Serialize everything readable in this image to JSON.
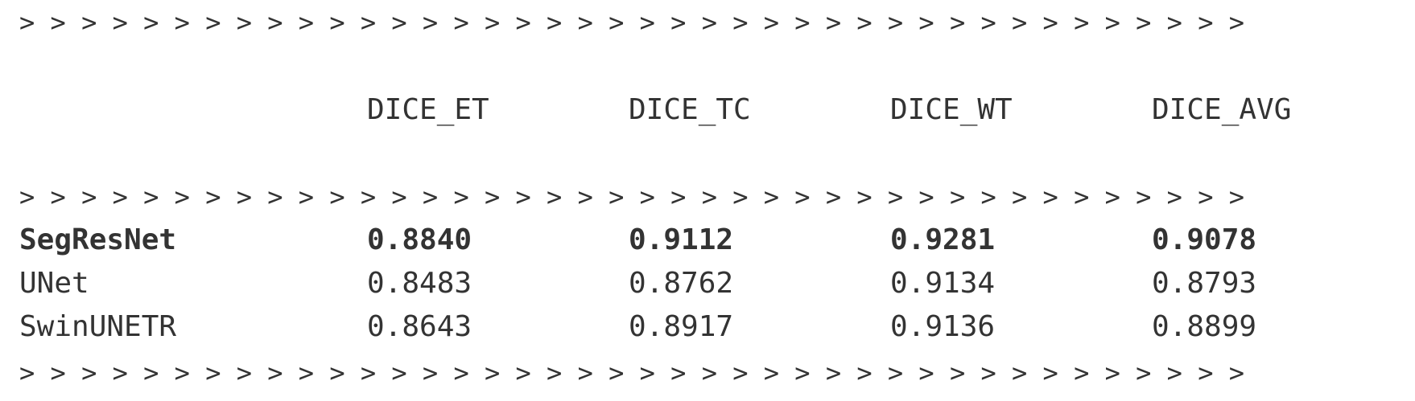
{
  "separator": "> > > > > > > > > > > > > > > > > > > > > > > > > > > > > > > > > > > > > > > >",
  "table": {
    "headers": [
      "",
      "DICE_ET",
      "DICE_TC",
      "DICE_WT",
      "DICE_AVG"
    ],
    "rows": [
      {
        "model": "SegResNet",
        "values": [
          "0.8840",
          "0.9112",
          "0.9281",
          "0.9078"
        ],
        "bold": true
      },
      {
        "model": "UNet",
        "values": [
          "0.8483",
          "0.8762",
          "0.9134",
          "0.8793"
        ],
        "bold": false
      },
      {
        "model": "SwinUNETR",
        "values": [
          "0.8643",
          "0.8917",
          "0.9136",
          "0.8899"
        ],
        "bold": false
      }
    ]
  }
}
